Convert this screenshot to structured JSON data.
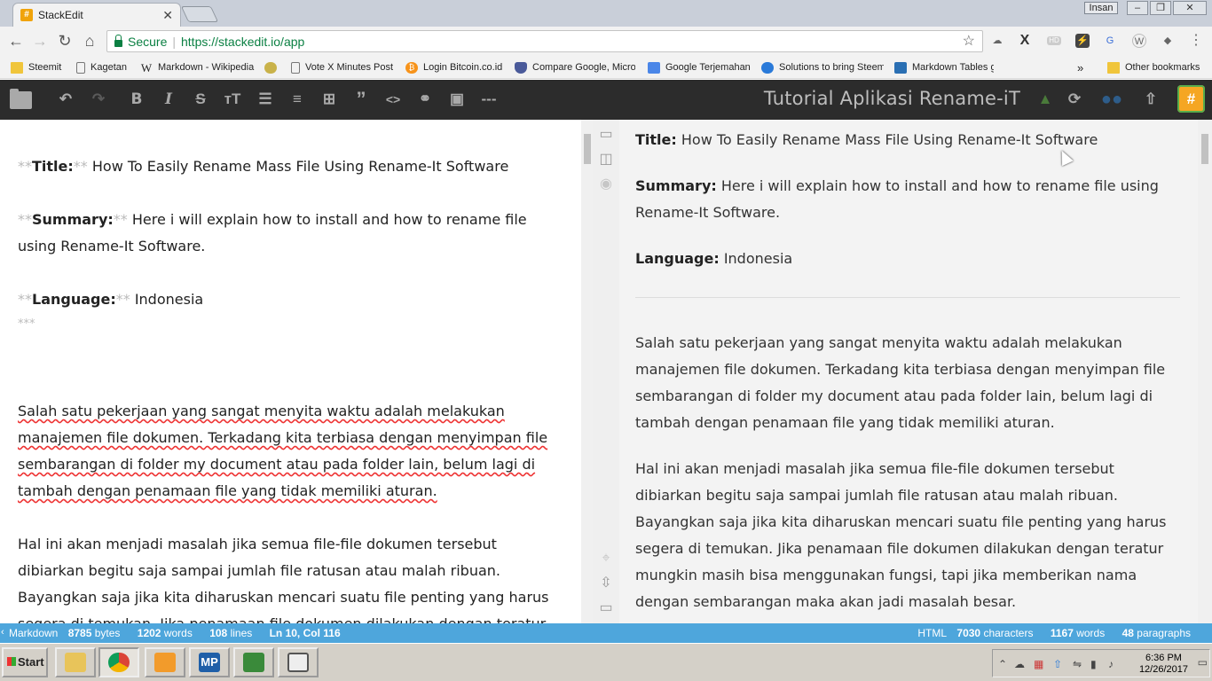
{
  "browser": {
    "tab_title": "StackEdit",
    "tab_favicon": "#",
    "user_label": "Insan",
    "secure_label": "Secure",
    "url": "https://stackedit.io/app"
  },
  "bookmarks": [
    {
      "label": "Steemit",
      "icon": "folder"
    },
    {
      "label": "Kagetan",
      "icon": "page"
    },
    {
      "label": "Markdown - Wikipedia",
      "icon": "wikipedia"
    },
    {
      "label": "",
      "icon": "coin"
    },
    {
      "label": "Vote X Minutes Post",
      "icon": "page"
    },
    {
      "label": "Login Bitcoin.co.id",
      "icon": "bitcoin"
    },
    {
      "label": "Compare Google, Micro",
      "icon": "shield"
    },
    {
      "label": "Google Terjemahan",
      "icon": "translate"
    },
    {
      "label": "Solutions to bring Steem",
      "icon": "steem"
    },
    {
      "label": "Markdown Tables gener",
      "icon": "table"
    },
    {
      "label": "Other bookmarks",
      "icon": "folder"
    }
  ],
  "stackedit": {
    "document_title": "Tutorial Aplikasi Rename-iT",
    "workspace_badge": "#"
  },
  "editor": {
    "title_md": "**",
    "title_label": "Title:",
    "title_value": " How To Easily Rename Mass File Using Rename-It Software",
    "summary_label": "Summary:",
    "summary_value": " Here i will explain how to install and how to rename file using Rename-It Software.",
    "language_label": "Language:",
    "language_value": " Indonesia",
    "hr_md": "***",
    "p1": "Salah satu pekerjaan yang sangat menyita waktu adalah melakukan manajemen file dokumen. Terkadang kita terbiasa dengan menyimpan file sembarangan di folder my document atau pada folder lain, belum lagi di tambah dengan penamaan file yang tidak memiliki aturan.",
    "p2": "Hal ini akan menjadi masalah jika semua file-file dokumen tersebut dibiarkan begitu saja sampai jumlah file ratusan atau malah ribuan. Bayangkan saja jika kita diharuskan mencari suatu file penting yang harus segera di temukan. Jika penamaan file dokumen dilakukan dengan teratur mungkin masih bisa"
  },
  "preview": {
    "title_label": "Title:",
    "title_value": " How To Easily Rename Mass File Using Rename-It Software",
    "summary_label": "Summary:",
    "summary_value": " Here i will explain how to install and how to rename file using Rename-It Software.",
    "language_label": "Language:",
    "language_value": " Indonesia",
    "p1": "Salah satu pekerjaan yang sangat menyita waktu adalah melakukan manajemen file dokumen. Terkadang kita terbiasa dengan menyimpan file sembarangan di folder my document atau pada folder lain, belum lagi di tambah dengan penamaan file yang tidak memiliki aturan.",
    "p2": "Hal ini akan menjadi masalah jika semua file-file dokumen tersebut dibiarkan begitu saja sampai jumlah file ratusan atau malah ribuan. Bayangkan saja jika kita diharuskan mencari suatu file penting yang harus segera di temukan. Jika penamaan file dokumen dilakukan dengan teratur mungkin masih bisa menggunakan fungsi, tapi jika memberikan nama dengan sembarangan maka akan jadi masalah besar."
  },
  "status": {
    "mode": "Markdown",
    "bytes": "8785",
    "bytes_label": "bytes",
    "words": "1202",
    "words_label": "words",
    "lines": "108",
    "lines_label": "lines",
    "position": "Ln 10, Col 116",
    "html_label": "HTML",
    "chars": "7030",
    "chars_label": "characters",
    "preview_words": "1167",
    "preview_words_label": "words",
    "paragraphs": "48",
    "paragraphs_label": "paragraphs"
  },
  "taskbar": {
    "start_label": "Start",
    "time": "6:36 PM",
    "date": "12/26/2017"
  },
  "colors": {
    "stackedit_nav": "#2c2c2c",
    "statusbar": "#4ea6dc",
    "secure_green": "#0b8043",
    "badge_orange": "#f5a623"
  }
}
